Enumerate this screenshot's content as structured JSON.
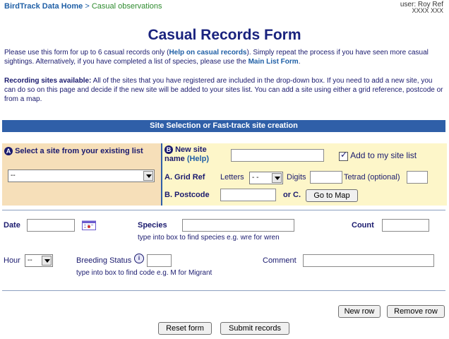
{
  "breadcrumb": {
    "home": "BirdTrack Data Home",
    "separator": ">",
    "current": "Casual observations"
  },
  "user": {
    "label": "user: Roy Ref",
    "sub": "XXXX XXX"
  },
  "page_title": "Casual Records Form",
  "intro": {
    "p1_start": "Please use this form for up to 6 casual records only (",
    "p1_link": "Help on casual records",
    "p1_mid": "). Simply repeat the process if you have seen more casual sightings. Alternatively, if you have completed a list of species, please use the ",
    "p1_link2": "Main List Form",
    "p1_end": ".",
    "p2_bold": "Recording sites available:",
    "p2_text": " All of the sites that you have registered are included in the drop-down box. If you need to add a new site, you can do so on this page and decide if the new site will be added to your sites list. You can add a site using either a grid reference, postcode or from a map."
  },
  "section_bar": "Site Selection or Fast-track site creation",
  "site_select": {
    "badge": "A",
    "label": "Select a site from your existing list",
    "value": "--"
  },
  "new_site": {
    "badge": "B",
    "label_line1": "New site",
    "label_line2": "name",
    "help": "(Help)",
    "add_checkbox_label": "Add to my site list",
    "grid_ref_label": "A. Grid Ref",
    "letters_label": "Letters",
    "letters_value": "- -",
    "digits_label": "Digits",
    "tetrad_label": "Tetrad (optional)",
    "postcode_label": "B. Postcode",
    "or_c": "or C.",
    "map_button": "Go to Map"
  },
  "record": {
    "date_label": "Date",
    "species_label": "Species",
    "species_hint": "type into box to find species e.g. wre for wren",
    "count_label": "Count",
    "hour_label": "Hour",
    "hour_value": "--",
    "breeding_label": "Breeding Status",
    "breeding_hint": "type into box to find code e.g. M for Migrant",
    "comment_label": "Comment"
  },
  "buttons": {
    "new_row": "New row",
    "remove_row": "Remove row",
    "reset": "Reset form",
    "submit": "Submit records"
  }
}
